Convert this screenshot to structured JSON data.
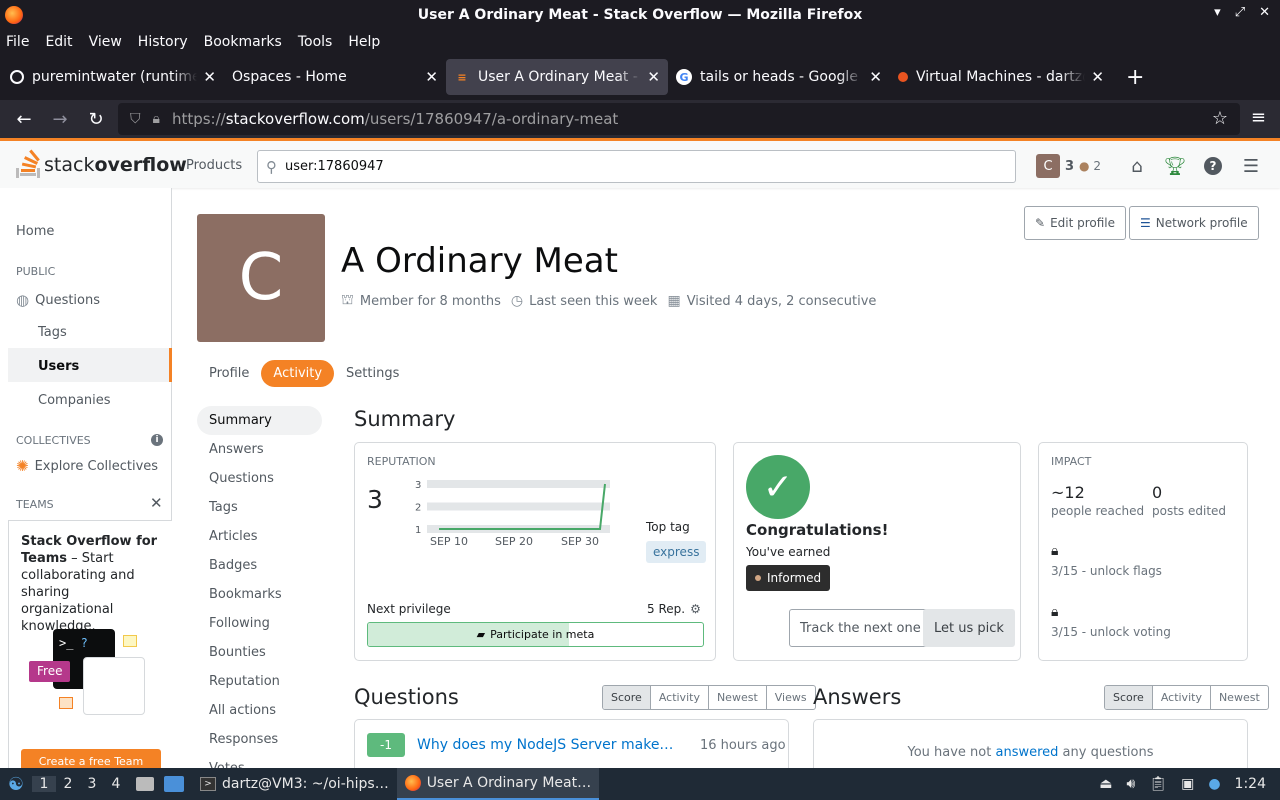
{
  "window": {
    "title": "User A Ordinary Meat - Stack Overflow — Mozilla Firefox",
    "menu": [
      "File",
      "Edit",
      "View",
      "History",
      "Bookmarks",
      "Tools",
      "Help"
    ],
    "tabs": [
      {
        "title": "puremintwater (runtime)",
        "icon": "globe-icon"
      },
      {
        "title": "Ospaces - Home",
        "icon": ""
      },
      {
        "title": "User A Ordinary Meat - Stack Overflow",
        "icon": "stackoverflow-icon"
      },
      {
        "title": "tails or heads - Google Search",
        "icon": "google-icon"
      },
      {
        "title": "Virtual Machines - dartz@",
        "icon": "ubuntu-icon"
      }
    ],
    "url_prefix": "https://",
    "url_host": "stackoverflow.com",
    "url_path": "/users/17860947/a-ordinary-meat"
  },
  "so_header": {
    "logo_light": "stack",
    "logo_bold": "overflow",
    "products": "Products",
    "search_value": "user:17860947",
    "avatar_letter": "C",
    "reputation": "3",
    "bronze_badges": "2"
  },
  "sidebar": {
    "home": "Home",
    "public": "PUBLIC",
    "questions": "Questions",
    "tags": "Tags",
    "users": "Users",
    "companies": "Companies",
    "collectives": "COLLECTIVES",
    "explore_collectives": "Explore Collectives",
    "teams": "TEAMS",
    "teams_title": "Stack Overflow for Teams",
    "teams_body": " – Start collaborating and sharing organizational knowledge.",
    "free": "Free",
    "create_team": "Create a free Team"
  },
  "profile": {
    "avatar_letter": "C",
    "name": "A Ordinary Meat",
    "member_for": "Member for 8 months",
    "last_seen": "Last seen this week",
    "visited": "Visited 4 days, 2 consecutive",
    "edit_profile": "Edit profile",
    "network_profile": "Network profile",
    "tabs": [
      "Profile",
      "Activity",
      "Settings"
    ]
  },
  "activity_nav": [
    "Summary",
    "Answers",
    "Questions",
    "Tags",
    "Articles",
    "Badges",
    "Bookmarks",
    "Following",
    "Bounties",
    "Reputation",
    "All actions",
    "Responses",
    "Votes"
  ],
  "summary": {
    "heading": "Summary",
    "reputation_label": "REPUTATION",
    "reputation_value": "3",
    "top_tag_label": "Top tag",
    "top_tag": "express",
    "next_privilege": "Next privilege",
    "next_rep": "5 Rep.",
    "privilege_name": "Participate in meta",
    "privilege_progress": 0.6,
    "congrats": "Congratulations!",
    "earned": "You've earned",
    "badge": "Informed",
    "track_next": "Track the next one",
    "let_us_pick": "Let us pick",
    "impact_label": "IMPACT",
    "people_reached": "~12",
    "people_reached_label": "people reached",
    "posts_edited": "0",
    "posts_edited_label": "posts edited",
    "unlock_flags": "3/15 - unlock flags",
    "unlock_voting": "3/15 - unlock voting"
  },
  "chart_data": {
    "type": "line",
    "x": [
      "SEP 10",
      "SEP 20",
      "SEP 30"
    ],
    "ylim": [
      1,
      3
    ],
    "yticks": [
      "3",
      "2",
      "1"
    ],
    "series": [
      {
        "values": [
          1,
          1,
          1,
          3
        ]
      }
    ]
  },
  "questions": {
    "heading": "Questions",
    "filters": [
      "Score",
      "Activity",
      "Newest",
      "Views"
    ],
    "items": [
      {
        "score": "-1",
        "title": "Why does my NodeJS Server make…",
        "time": "16 hours ago"
      }
    ]
  },
  "answers": {
    "heading": "Answers",
    "filters": [
      "Score",
      "Activity",
      "Newest"
    ],
    "empty_pre": "You have not ",
    "empty_link": "answered",
    "empty_post": " any questions"
  },
  "taskbar": {
    "workspaces": [
      "1",
      "2",
      "3",
      "4"
    ],
    "task1": "dartz@VM3: ~/oi-hips…",
    "task2": "User A Ordinary Meat…",
    "clock": "1:24"
  }
}
